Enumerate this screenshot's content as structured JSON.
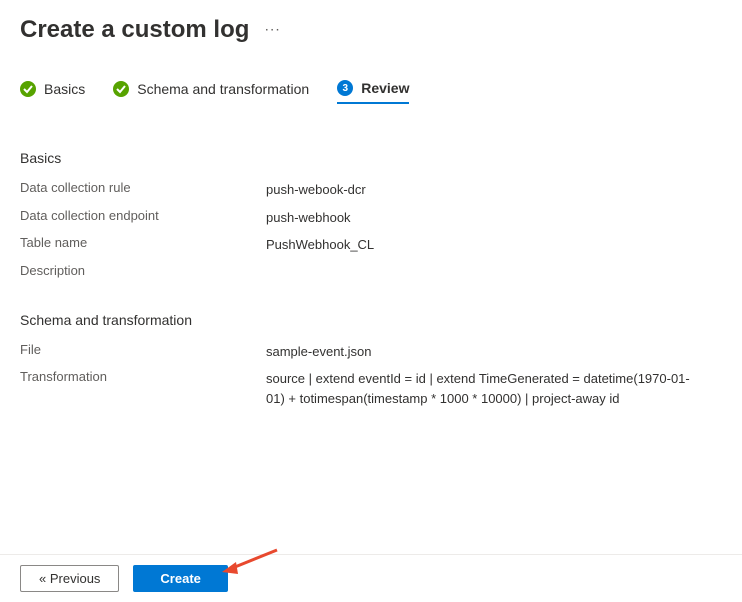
{
  "title": "Create a custom log",
  "steps": [
    {
      "label": "Basics",
      "kind": "check"
    },
    {
      "label": "Schema and transformation",
      "kind": "check"
    },
    {
      "label": "Review",
      "kind": "num",
      "num": "3",
      "active": true
    }
  ],
  "sections": {
    "basics": {
      "title": "Basics",
      "rows": [
        {
          "label": "Data collection rule",
          "value": "push-webook-dcr"
        },
        {
          "label": "Data collection endpoint",
          "value": "push-webhook"
        },
        {
          "label": "Table name",
          "value": "PushWebhook_CL"
        },
        {
          "label": "Description",
          "value": ""
        }
      ]
    },
    "schema": {
      "title": "Schema and transformation",
      "rows": [
        {
          "label": "File",
          "value": "sample-event.json"
        },
        {
          "label": "Transformation",
          "value": "source | extend eventId = id | extend TimeGenerated = datetime(1970-01-01) + totimespan(timestamp * 1000 * 10000) | project-away id"
        }
      ]
    }
  },
  "footer": {
    "previous_label": "« Previous",
    "create_label": "Create"
  }
}
